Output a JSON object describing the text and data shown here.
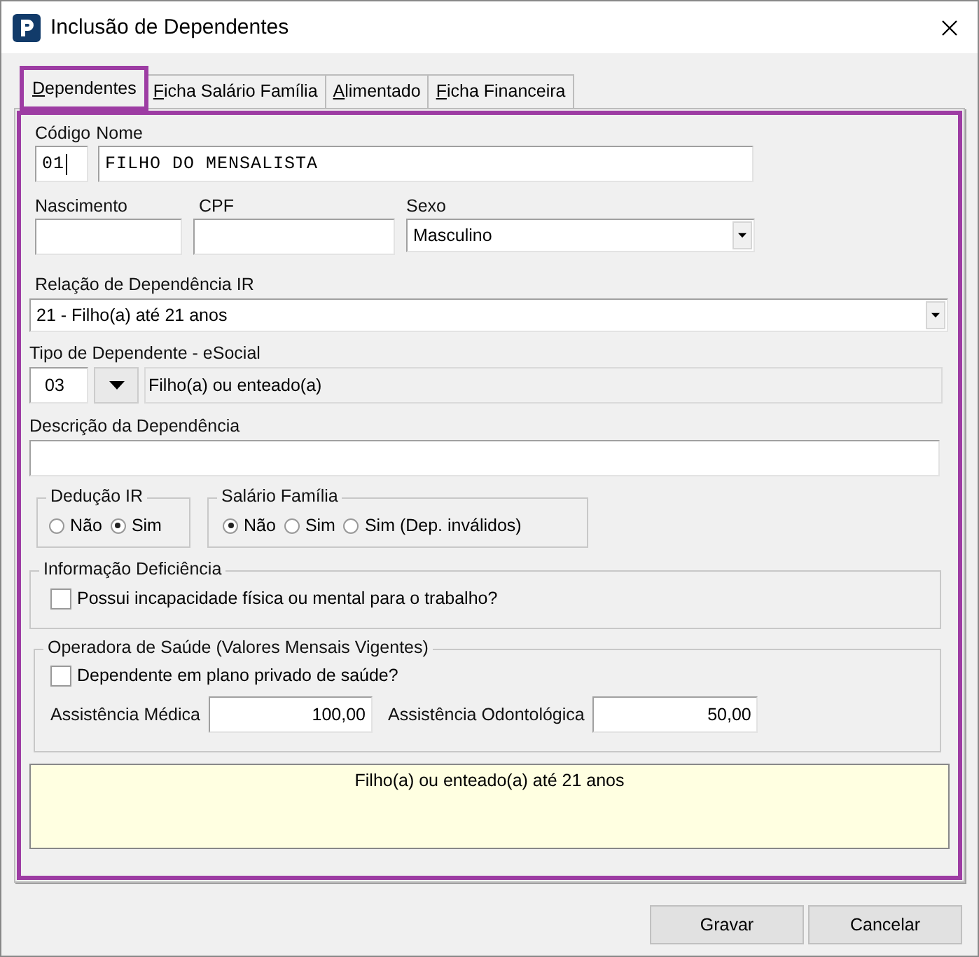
{
  "window": {
    "title": "Inclusão de Dependentes"
  },
  "tabs": [
    {
      "label": "Dependentes",
      "selected": true,
      "highlighted": true
    },
    {
      "label": "Ficha Salário Família",
      "selected": false,
      "highlighted": false
    },
    {
      "label": "Alimentado",
      "selected": false,
      "highlighted": false
    },
    {
      "label": "Ficha Financeira",
      "selected": false,
      "highlighted": false
    }
  ],
  "panel": {
    "highlighted": true
  },
  "codigo": {
    "label": "Código",
    "value": "01"
  },
  "nome": {
    "label": "Nome",
    "value": "FILHO DO MENSALISTA"
  },
  "nascimento": {
    "label": "Nascimento"
  },
  "cpf": {
    "label": "CPF"
  },
  "sexo": {
    "label": "Sexo",
    "value": "Masculino"
  },
  "relacao_ir": {
    "label": "Relação de Dependência IR",
    "value": "21 - Filho(a) até 21 anos"
  },
  "tipo_esocial": {
    "label": "Tipo de Dependente - eSocial",
    "code": "03",
    "description": "Filho(a) ou enteado(a)"
  },
  "descricao": {
    "label": "Descrição da Dependência"
  },
  "deducao_ir": {
    "title": "Dedução IR",
    "options": [
      {
        "label": "Não",
        "selected": false
      },
      {
        "label": "Sim",
        "selected": true
      }
    ]
  },
  "salario_familia": {
    "title": "Salário Família",
    "options": [
      {
        "label": "Não",
        "selected": true
      },
      {
        "label": "Sim",
        "selected": false
      },
      {
        "label": "Sim (Dep. inválidos)",
        "selected": false
      }
    ]
  },
  "deficiencia": {
    "title": "Informação Deficiência",
    "checkbox": {
      "label": "Possui incapacidade física ou mental para o trabalho?",
      "checked": false
    }
  },
  "operadora": {
    "title": "Operadora de Saúde (Valores Mensais Vigentes)",
    "checkbox": {
      "label": "Dependente em plano privado de saúde?",
      "checked": false
    },
    "medica": {
      "label": "Assistência Médica",
      "value": "100,00"
    },
    "odonto": {
      "label": "Assistência Odontológica",
      "value": "50,00"
    }
  },
  "info": {
    "text": "Filho(a) ou enteado(a) até 21 anos"
  },
  "buttons": [
    {
      "label": "Gravar"
    },
    {
      "label": "Cancelar"
    }
  ]
}
